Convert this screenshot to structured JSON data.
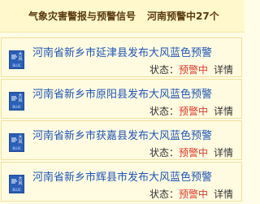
{
  "header": {
    "title": "气象灾害警报与预警信号",
    "count": "河南预警中27个"
  },
  "badge": {
    "text": "大风",
    "sub": "BLUE"
  },
  "alerts": [
    {
      "title": "河南省新乡市延津县发布大风蓝色预警",
      "status_label": "状态：",
      "status_value": "预警中",
      "detail": "详情"
    },
    {
      "title": "河南省新乡市原阳县发布大风蓝色预警",
      "status_label": "状态：",
      "status_value": "预警中",
      "detail": "详情"
    },
    {
      "title": "河南省新乡市获嘉县发布大风蓝色预警",
      "status_label": "状态：",
      "status_value": "预警中",
      "detail": "详情"
    },
    {
      "title": "河南省新乡市辉县市发布大风蓝色预警",
      "status_label": "状态：",
      "status_value": "预警中",
      "detail": "详情"
    }
  ],
  "colors": {
    "title_blue": "#1f56b8",
    "status_red": "#e03a2a",
    "badge_blue": "#2a5fb8"
  },
  "icons": {
    "badge": "wind-warning-blue-icon"
  }
}
